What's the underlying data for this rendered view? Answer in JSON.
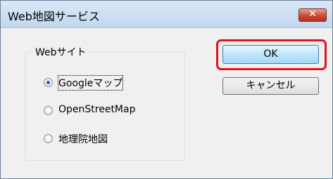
{
  "window": {
    "title": "Web地図サービス",
    "close_glyph": "✕"
  },
  "group": {
    "label": "Webサイト",
    "options": [
      {
        "label": "Googleマップ",
        "selected": true
      },
      {
        "label": "OpenStreetMap",
        "selected": false
      },
      {
        "label": "地理院地図",
        "selected": false
      }
    ]
  },
  "buttons": {
    "ok": "OK",
    "cancel": "キャンセル"
  },
  "colors": {
    "highlight": "#e01420",
    "radio_dot": "#1f5fc4"
  }
}
